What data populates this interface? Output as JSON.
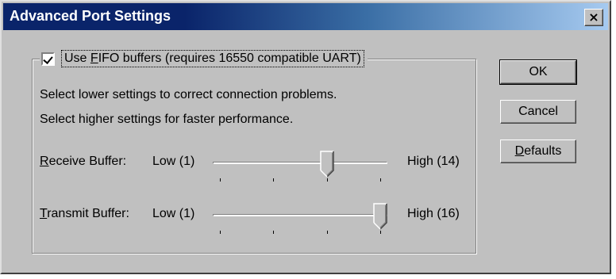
{
  "window": {
    "title": "Advanced Port Settings",
    "close_glyph": "×"
  },
  "fifo": {
    "checked": true,
    "label_prefix": "Use ",
    "label_hotkey": "F",
    "label_rest": "IFO buffers (requires 16550 compatible UART)"
  },
  "info": {
    "line1": "Select lower settings to correct connection problems.",
    "line2": "Select higher settings for faster performance."
  },
  "receive": {
    "label_hotkey": "R",
    "label_rest": "eceive Buffer:",
    "low": "Low (1)",
    "high": "High (14)",
    "positions": 4,
    "selected_index": 2
  },
  "transmit": {
    "label_hotkey": "T",
    "label_rest": "ransmit Buffer:",
    "low": "Low (1)",
    "high": "High (16)",
    "positions": 4,
    "selected_index": 3
  },
  "buttons": {
    "ok": "OK",
    "cancel": "Cancel",
    "defaults_hotkey": "D",
    "defaults_rest": "efaults"
  },
  "colors": {
    "dialog_bg": "#c0c0c0",
    "title_start": "#0a246a",
    "title_end": "#a6caf0"
  }
}
